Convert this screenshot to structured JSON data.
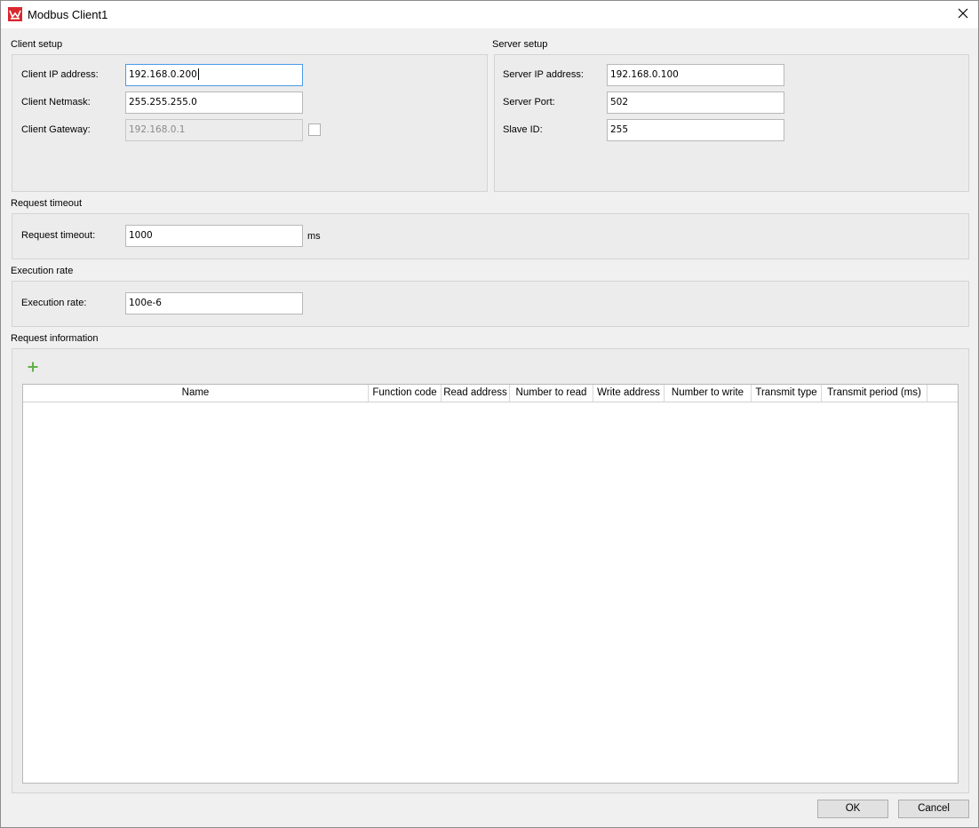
{
  "window": {
    "title": "Modbus Client1",
    "app_icon": "app-logo-icon",
    "close_icon": "close-icon"
  },
  "client_setup": {
    "label": "Client setup",
    "ip_label": "Client IP address:",
    "ip_value": "192.168.0.200",
    "netmask_label": "Client Netmask:",
    "netmask_value": "255.255.255.0",
    "gateway_label": "Client Gateway:",
    "gateway_value": "192.168.0.1",
    "gateway_enabled": false
  },
  "server_setup": {
    "label": "Server setup",
    "ip_label": "Server IP address:",
    "ip_value": "192.168.0.100",
    "port_label": "Server Port:",
    "port_value": "502",
    "slave_label": "Slave ID:",
    "slave_value": "255"
  },
  "request_timeout": {
    "label": "Request timeout",
    "field_label": "Request timeout:",
    "value": "1000",
    "unit": "ms"
  },
  "execution_rate": {
    "label": "Execution rate",
    "field_label": "Execution rate:",
    "value": "100e-6"
  },
  "request_information": {
    "label": "Request information",
    "add_icon": "plus-icon",
    "columns": [
      "Name",
      "Function code",
      "Read address",
      "Number to read",
      "Write address",
      "Number to write",
      "Transmit type",
      "Transmit period (ms)"
    ],
    "rows": []
  },
  "buttons": {
    "ok": "OK",
    "cancel": "Cancel"
  },
  "colors": {
    "accent_focus": "#4a9be8",
    "add_green": "#5fb04b",
    "logo_red": "#d9272e"
  }
}
